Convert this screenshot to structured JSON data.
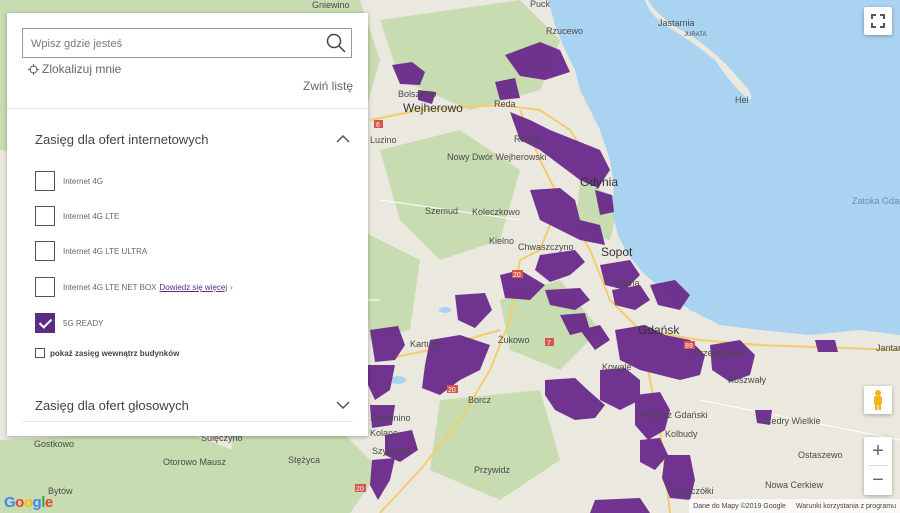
{
  "search": {
    "placeholder": "Wpisz gdzie jesteś"
  },
  "panel": {
    "locate_label": "Zlokalizuj mnie",
    "collapse_label": "Zwiń listę",
    "internet_section": {
      "title": "Zasięg dla ofert internetowych",
      "options": [
        {
          "label": "Internet 4G",
          "checked": false
        },
        {
          "label": "Internet 4G LTE",
          "checked": false
        },
        {
          "label": "Internet 4G LTE ULTRA",
          "checked": false
        },
        {
          "label": "Internet 4G LTE NET BOX",
          "link": "Dowiedz się więcej",
          "checked": false
        },
        {
          "label": "5G READY",
          "checked": true
        }
      ],
      "indoor_label": "pokaż zasięg wewnątrz budynków"
    },
    "voice_section": {
      "title": "Zasięg dla ofert głosowych"
    }
  },
  "map": {
    "places": [
      "Gniewino",
      "Puck",
      "Rzucewo",
      "Jastarnia",
      "JURATA",
      "Hel",
      "Bolszewo",
      "Wejherowo",
      "Reda",
      "Rumia",
      "Nowy Dwór Wejherowski",
      "Gdynia",
      "Szemud",
      "Koleczkowo",
      "Zatoka Gdańska",
      "Kielno",
      "Chwaszczyno",
      "Sopot",
      "Kartuzy",
      "Żukowo",
      "Gdańsk",
      "Przejazdowo",
      "Jantar",
      "Kowale",
      "Koszwały",
      "Cedry Wielkie",
      "Borcz",
      "Somonino",
      "Gostkowo",
      "Sulęczyno",
      "Otorowo Mausz",
      "Stężyca",
      "Szymbark",
      "Przywidz",
      "Pszczółki",
      "Bytów",
      "Nowa Cerkiew",
      "Ostaszewo",
      "Pruszcz Gdański",
      "Kolbudy",
      "Luzino",
      "Olivia",
      "Kolano"
    ],
    "road_numbers": [
      "6",
      "20",
      "7",
      "20",
      "20",
      "89"
    ],
    "coverage_color": "#6b2a8c",
    "water_color": "#aad3f2",
    "land_color": "#ebe8df",
    "forest_color": "#c7dcb0"
  },
  "controls": {
    "fullscreen_icon": "fullscreen-icon",
    "pegman_icon": "pegman-icon",
    "zoom_in": "+",
    "zoom_out": "−"
  },
  "footer": {
    "logo": "Google",
    "map_data": "Dane do Mapy ©2019 Google",
    "terms": "Warunki korzystania z programu"
  }
}
